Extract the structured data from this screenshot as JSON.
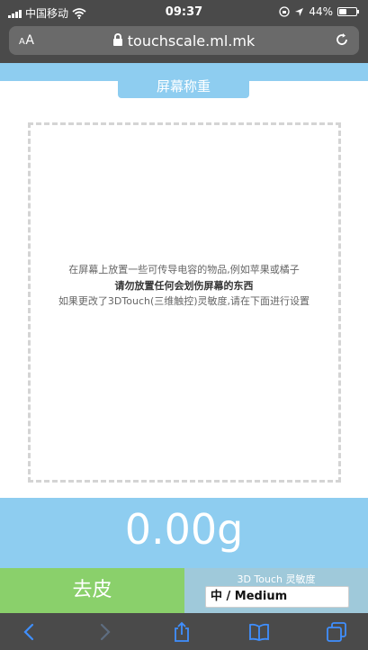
{
  "status_bar": {
    "carrier": "中国移动",
    "time": "09:37",
    "battery_percent": "44%",
    "battery_level": 0.44
  },
  "browser": {
    "text_size_label": "AA",
    "url": "touchscale.ml.mk"
  },
  "page": {
    "title": "屏幕称重",
    "instructions": {
      "line1": "在屏幕上放置一些可传导电容的物品,例如苹果或橘子",
      "line2": "请勿放置任何会划伤屏幕的东西",
      "line3": "如果更改了3DTouch(三维触控)灵敏度,请在下面进行设置"
    },
    "weight": "0.00g",
    "tare_label": "去皮",
    "sensitivity_label": "3D Touch 灵敏度",
    "sensitivity_value": "中 / Medium"
  },
  "colors": {
    "accent_blue": "#8ecdf0",
    "tare_green": "#8ad06b",
    "chrome": "#4a4a4a"
  },
  "icons": {
    "status": [
      "signal-icon",
      "wifi-icon",
      "orientation-lock-icon",
      "location-icon",
      "battery-icon"
    ],
    "toolbar": [
      "back-icon",
      "forward-icon",
      "share-icon",
      "bookmarks-icon",
      "tabs-icon"
    ]
  }
}
